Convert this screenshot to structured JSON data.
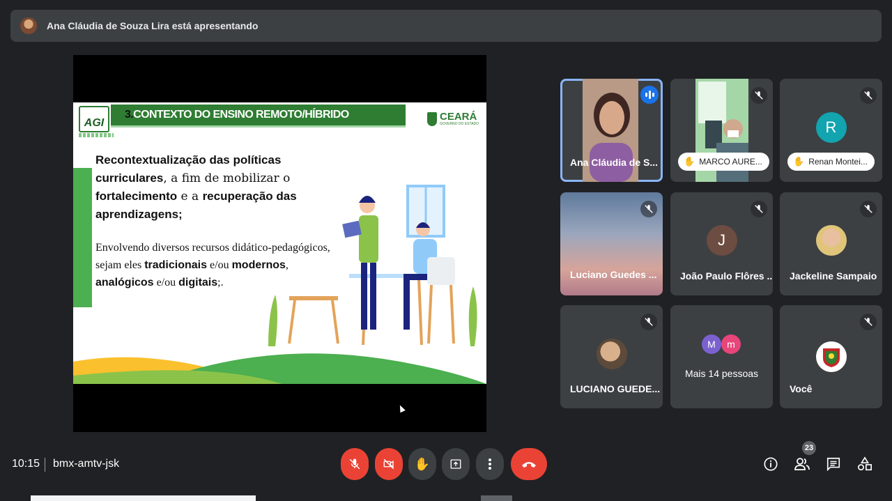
{
  "banner": {
    "text": "Ana Cláudia de Souza Lira está apresentando"
  },
  "slide": {
    "title_num": "3.",
    "title": "CONTEXTO DO ENSINO REMOTO/HÍBRIDO",
    "agi_logo": "AGI",
    "ceara_logo": "CEARÁ",
    "ceara_sub": "GOVERNO DO ESTADO",
    "para1": [
      {
        "t": "Recontextualização das políticas curriculares",
        "b": true
      },
      {
        "t": ", a fim de mobilizar o ",
        "b": false
      },
      {
        "t": "fortalecimento",
        "b": true
      },
      {
        "t": " e a ",
        "b": false
      },
      {
        "t": "recuperação das aprendizagens;",
        "b": true
      }
    ],
    "para2": [
      {
        "t": "Envolvendo diversos  recursos didático-pedagógicos,  sejam eles ",
        "b": false
      },
      {
        "t": "tradicionais",
        "b": true
      },
      {
        "t": " e/ou ",
        "b": false
      },
      {
        "t": "modernos",
        "b": true
      },
      {
        "t": ", ",
        "b": false
      },
      {
        "t": "analógicos",
        "b": true
      },
      {
        "t": " e/ou ",
        "b": false
      },
      {
        "t": "digitais",
        "b": true
      },
      {
        "t": ";.",
        "b": false
      }
    ]
  },
  "participants": [
    {
      "name": "Ana Cláudia de S...",
      "speaking": true
    },
    {
      "name": "MARCO AURE...",
      "hand_raised": true
    },
    {
      "name": "Renan Montei...",
      "initial": "R",
      "color": "#12a4af",
      "hand_raised": true
    },
    {
      "name": "Luciano Guedes ..."
    },
    {
      "name": "João Paulo Flôres ...",
      "initial": "J",
      "color": "#6d4c41"
    },
    {
      "name": "Jackeline Sampaio"
    },
    {
      "name": "LUCIANO GUEDE..."
    },
    {
      "name": "Mais 14 pessoas",
      "initials": [
        "M",
        "m"
      ],
      "colors": [
        "#7b61d0",
        "#e8457a"
      ]
    },
    {
      "name": "Você"
    }
  ],
  "bottom": {
    "time": "10:15",
    "meeting_code": "bmx-amtv-jsk",
    "participant_count": "23",
    "icons": [
      "mic-off-icon",
      "camera-off-icon",
      "raise-hand-icon",
      "present-icon",
      "more-icon",
      "end-call-icon",
      "info-icon",
      "people-icon",
      "chat-icon",
      "activities-icon"
    ]
  }
}
